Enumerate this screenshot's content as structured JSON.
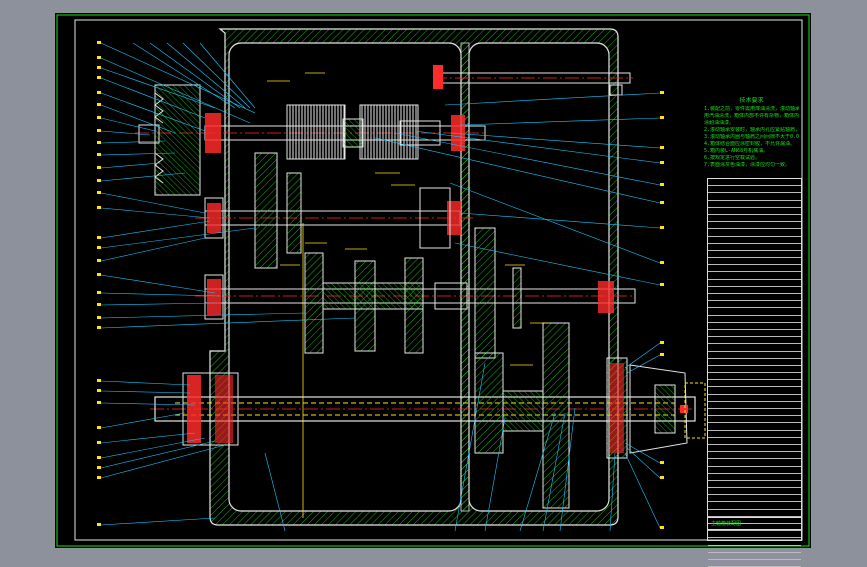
{
  "drawing": {
    "background": "#000000",
    "colors": {
      "outline": "#e6e6e6",
      "hatch": "#19e019",
      "leader": "#18c8ff",
      "centerline": "#ff2a2a",
      "hidden": "#ffe21a",
      "bearing": "#ff2a2a",
      "gear": "#ffcc00",
      "frame": "#19e019",
      "canvas_border": "#8c919c"
    },
    "notes_title": "技术要求",
    "notes_lines": [
      "1.装配之前，零件需用煤油清洗，滚动轴承",
      "用汽油清洗，箱体内部不许有杂物，箱体内壁",
      "涂耐油油漆。",
      "2.滚动轴承安装时，轴承内孔应紧贴轴肩，",
      "3.滚动轴承内圈与轴肩之间间隙不大于0.05mm。",
      "4.箱体结合面应涂密封胶，不允许漏油。",
      "5.箱内装L-AN68号机械油。",
      "6.按规定进行空载试验。",
      "7.表面涂灰色油漆，涂漆应均匀一致。"
    ],
    "title_block_text": "主轴箱装配图"
  }
}
